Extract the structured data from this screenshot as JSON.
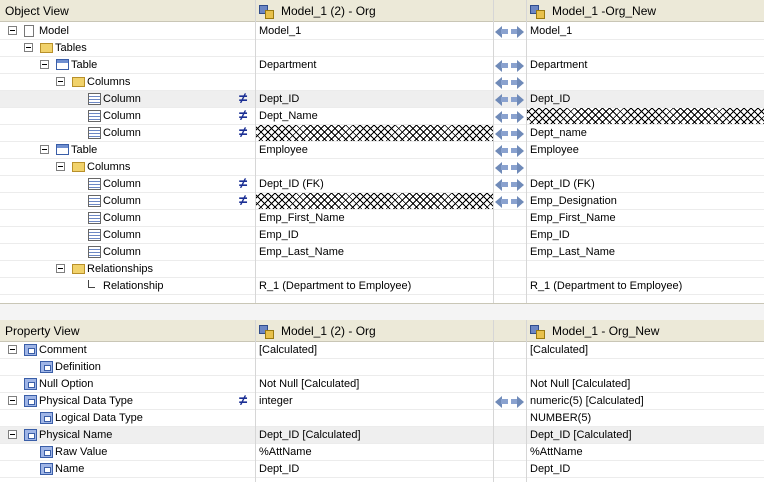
{
  "object_view": {
    "header": {
      "title": "Object View",
      "left_model": "Model_1 (2) -  Org",
      "right_model": "Model_1 -Org_New"
    },
    "rows": [
      {
        "indent": 0,
        "toggle": true,
        "icon": "document-icon",
        "label": "Model",
        "left": "Model_1",
        "right": "Model_1",
        "arrows": true,
        "diff": false,
        "hatch": ""
      },
      {
        "indent": 1,
        "toggle": true,
        "icon": "folder-icon",
        "label": "Tables",
        "left": "",
        "right": "",
        "arrows": false,
        "diff": false,
        "hatch": ""
      },
      {
        "indent": 2,
        "toggle": true,
        "icon": "table-icon",
        "label": "Table",
        "left": "Department",
        "right": "Department",
        "arrows": true,
        "diff": false,
        "hatch": ""
      },
      {
        "indent": 3,
        "toggle": true,
        "icon": "folder-icon",
        "label": "Columns",
        "left": "",
        "right": "",
        "arrows": true,
        "diff": false,
        "hatch": ""
      },
      {
        "indent": 4,
        "toggle": false,
        "icon": "column-icon",
        "label": "Column",
        "left": "Dept_ID",
        "right": "Dept_ID",
        "arrows": true,
        "diff": true,
        "hatch": "",
        "selected": true
      },
      {
        "indent": 4,
        "toggle": false,
        "icon": "column-icon",
        "label": "Column",
        "left": "Dept_Name",
        "right": "",
        "arrows": true,
        "diff": true,
        "hatch": "right"
      },
      {
        "indent": 4,
        "toggle": false,
        "icon": "column-icon",
        "label": "Column",
        "left": "",
        "right": "Dept_name",
        "arrows": true,
        "diff": true,
        "hatch": "left"
      },
      {
        "indent": 2,
        "toggle": true,
        "icon": "table-icon",
        "label": "Table",
        "left": "Employee",
        "right": "Employee",
        "arrows": true,
        "diff": false,
        "hatch": ""
      },
      {
        "indent": 3,
        "toggle": true,
        "icon": "folder-icon",
        "label": "Columns",
        "left": "",
        "right": "",
        "arrows": true,
        "diff": false,
        "hatch": ""
      },
      {
        "indent": 4,
        "toggle": false,
        "icon": "column-icon",
        "label": "Column",
        "left": "Dept_ID (FK)",
        "right": "Dept_ID (FK)",
        "arrows": true,
        "diff": true,
        "hatch": ""
      },
      {
        "indent": 4,
        "toggle": false,
        "icon": "column-icon",
        "label": "Column",
        "left": "",
        "right": "Emp_Designation",
        "arrows": true,
        "diff": true,
        "hatch": "left"
      },
      {
        "indent": 4,
        "toggle": false,
        "icon": "column-icon",
        "label": "Column",
        "left": "Emp_First_Name",
        "right": "Emp_First_Name",
        "arrows": false,
        "diff": false,
        "hatch": ""
      },
      {
        "indent": 4,
        "toggle": false,
        "icon": "column-icon",
        "label": "Column",
        "left": "Emp_ID",
        "right": "Emp_ID",
        "arrows": false,
        "diff": false,
        "hatch": ""
      },
      {
        "indent": 4,
        "toggle": false,
        "icon": "column-icon",
        "label": "Column",
        "left": "Emp_Last_Name",
        "right": "Emp_Last_Name",
        "arrows": false,
        "diff": false,
        "hatch": ""
      },
      {
        "indent": 3,
        "toggle": true,
        "icon": "folder-icon",
        "label": "Relationships",
        "left": "",
        "right": "",
        "arrows": false,
        "diff": false,
        "hatch": ""
      },
      {
        "indent": 4,
        "toggle": false,
        "icon": "relationship-icon",
        "label": "Relationship",
        "left": "R_1 (Department to Employee)",
        "right": "R_1 (Department to Employee)",
        "arrows": false,
        "diff": false,
        "hatch": ""
      }
    ]
  },
  "property_view": {
    "header": {
      "title": "Property View",
      "left_model": "Model_1 (2) -  Org",
      "right_model": "Model_1 - Org_New"
    },
    "rows": [
      {
        "indent": 0,
        "toggle": true,
        "label": "Comment",
        "left": "[Calculated]",
        "right": "[Calculated]",
        "arrows": false,
        "diff": false
      },
      {
        "indent": 1,
        "toggle": false,
        "label": "Definition",
        "left": "",
        "right": "",
        "arrows": false,
        "diff": false
      },
      {
        "indent": 0,
        "toggle": false,
        "label": "Null Option",
        "left": "Not Null [Calculated]",
        "right": "Not Null [Calculated]",
        "arrows": false,
        "diff": false
      },
      {
        "indent": 0,
        "toggle": true,
        "label": "Physical Data Type",
        "left": "integer",
        "right": "numeric(5) [Calculated]",
        "arrows": true,
        "diff": true
      },
      {
        "indent": 1,
        "toggle": false,
        "label": "Logical Data Type",
        "left": "",
        "right": "NUMBER(5)",
        "arrows": false,
        "diff": false
      },
      {
        "indent": 0,
        "toggle": true,
        "label": "Physical Name",
        "left": "Dept_ID [Calculated]",
        "right": "Dept_ID [Calculated]",
        "arrows": false,
        "diff": false,
        "selected": true
      },
      {
        "indent": 1,
        "toggle": false,
        "label": "Raw Value",
        "left": "%AttName",
        "right": "%AttName",
        "arrows": false,
        "diff": false
      },
      {
        "indent": 1,
        "toggle": false,
        "label": "Name",
        "left": "Dept_ID",
        "right": "Dept_ID",
        "arrows": false,
        "diff": false
      }
    ]
  }
}
